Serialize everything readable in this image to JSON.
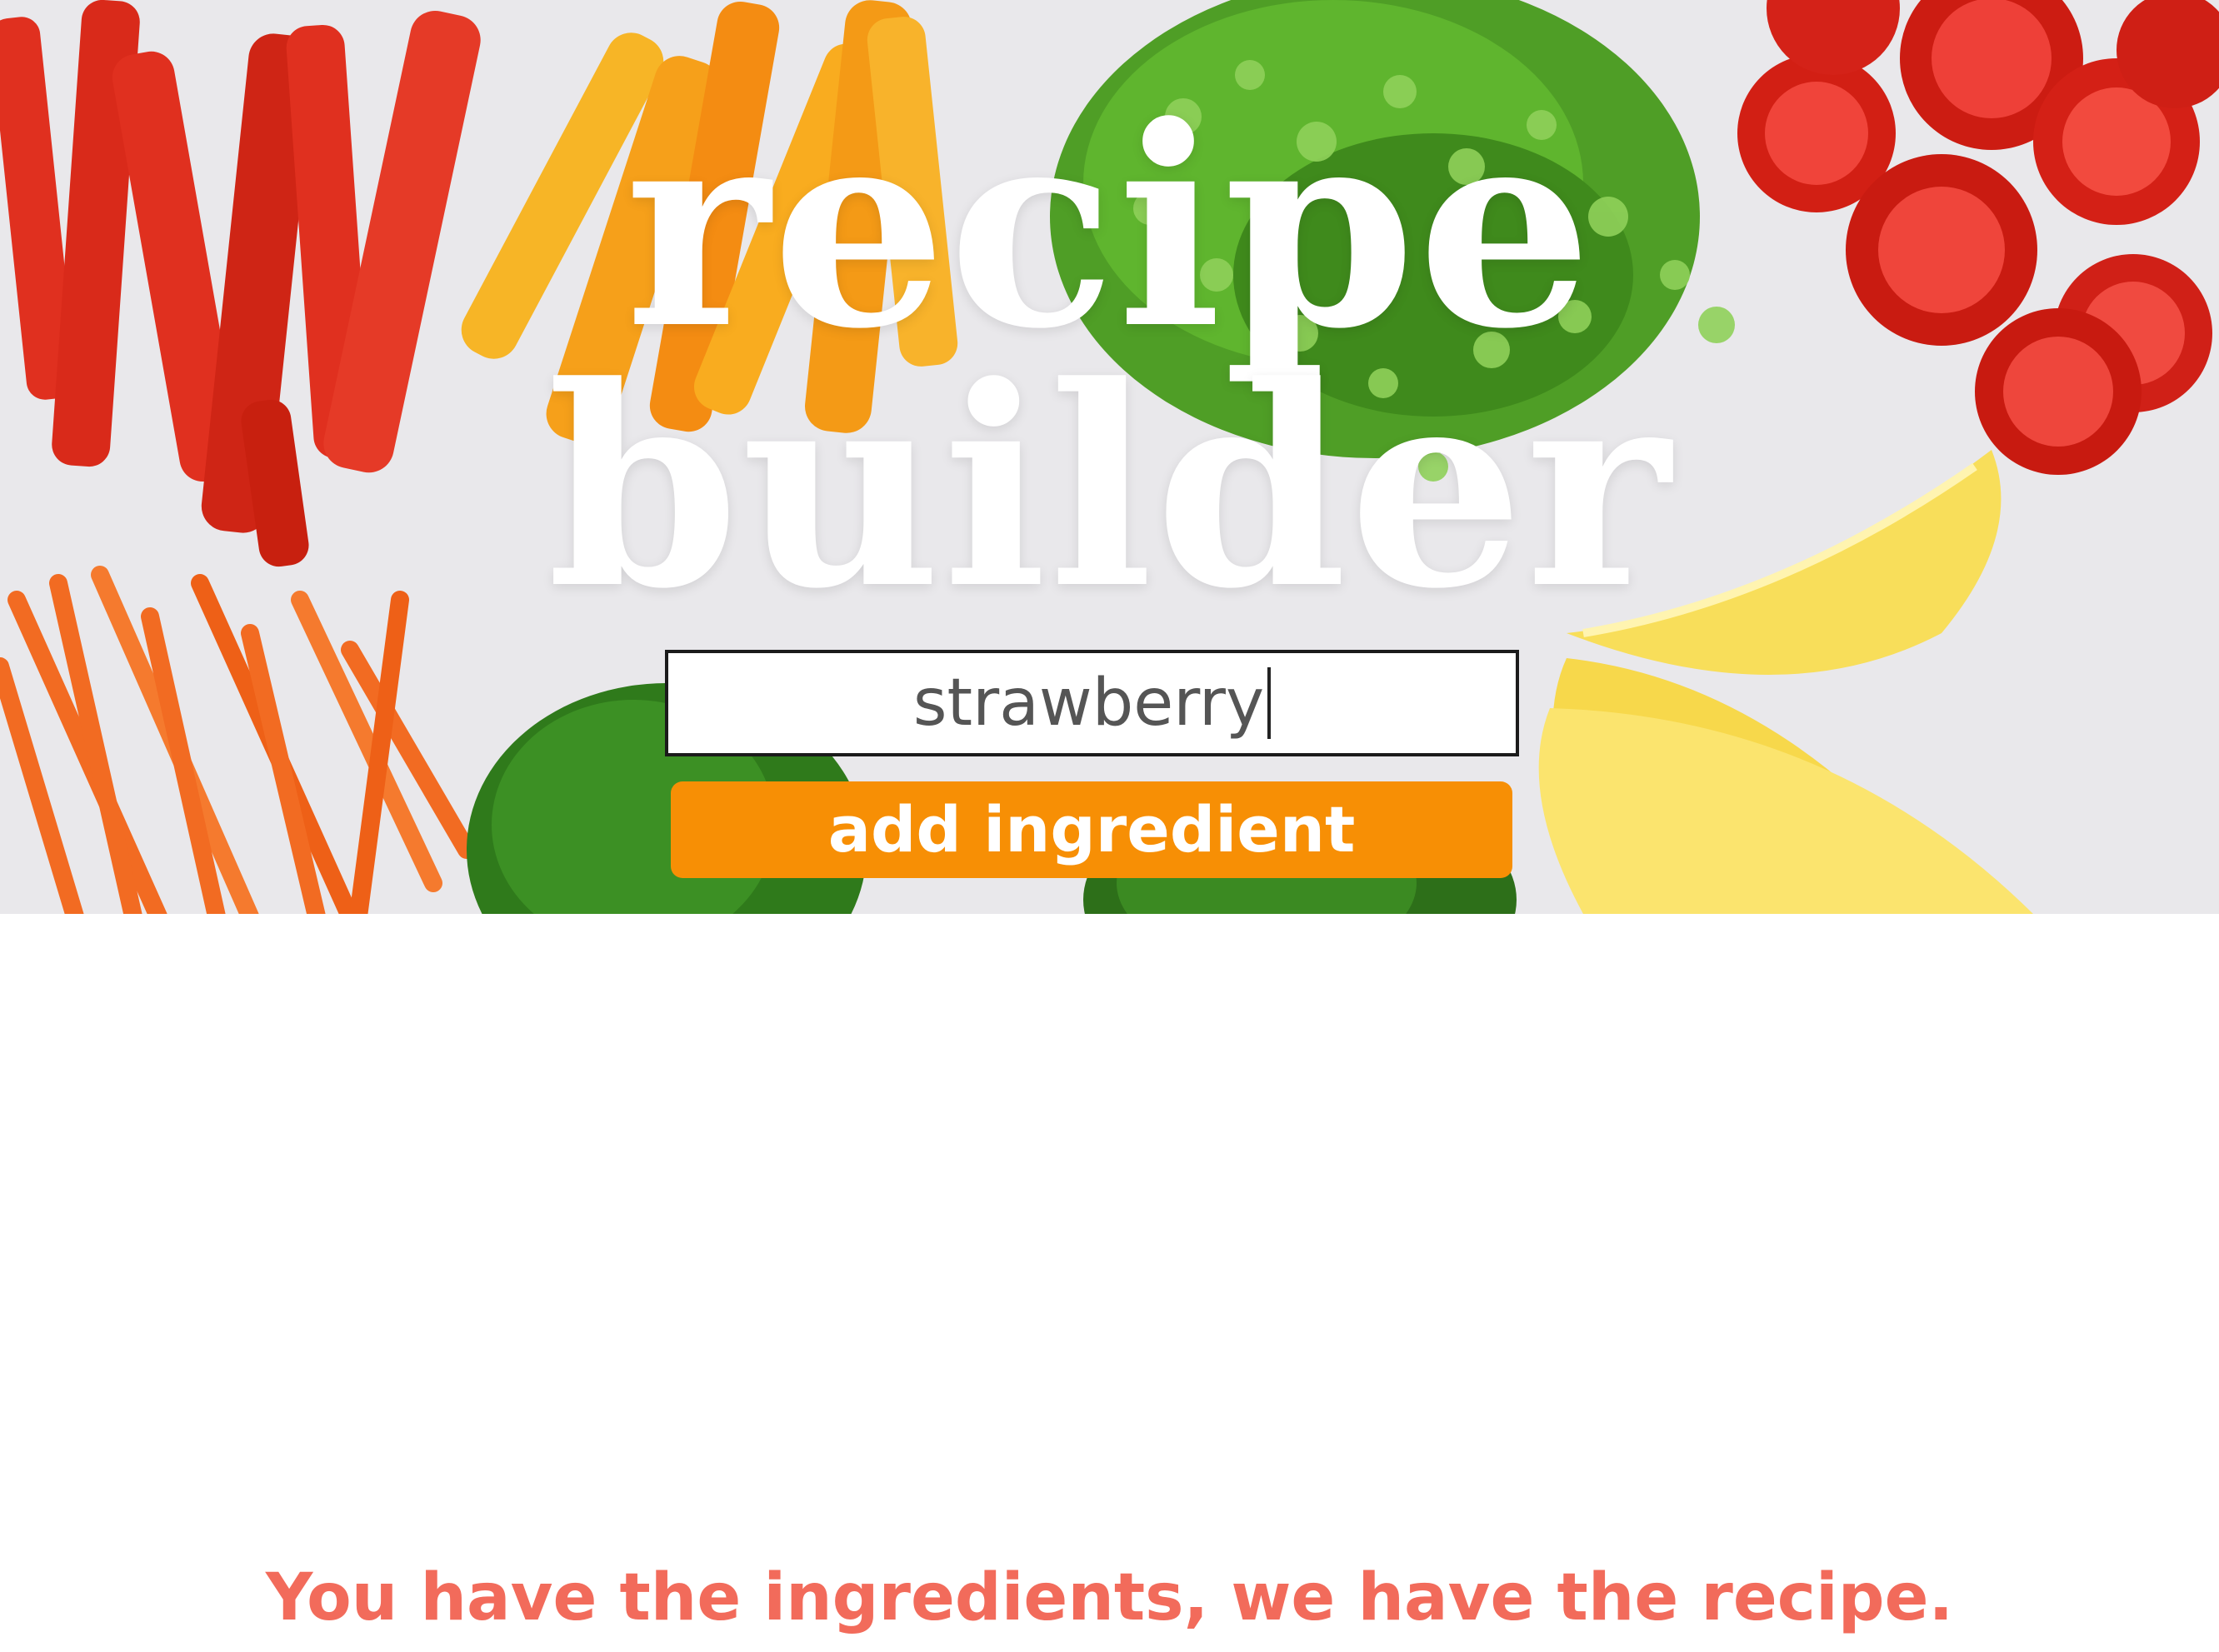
{
  "hero": {
    "title_line_1": "recipe",
    "title_line_2": "builder",
    "background_image": "chopped-vegetables-photo"
  },
  "ingredient_input": {
    "value": "strawberry"
  },
  "add_button": {
    "label": "add ingredient",
    "color": "#f78f05"
  },
  "tagline": {
    "text": "You have the ingredients, we have the recipe.",
    "color": "#f26b5b"
  }
}
